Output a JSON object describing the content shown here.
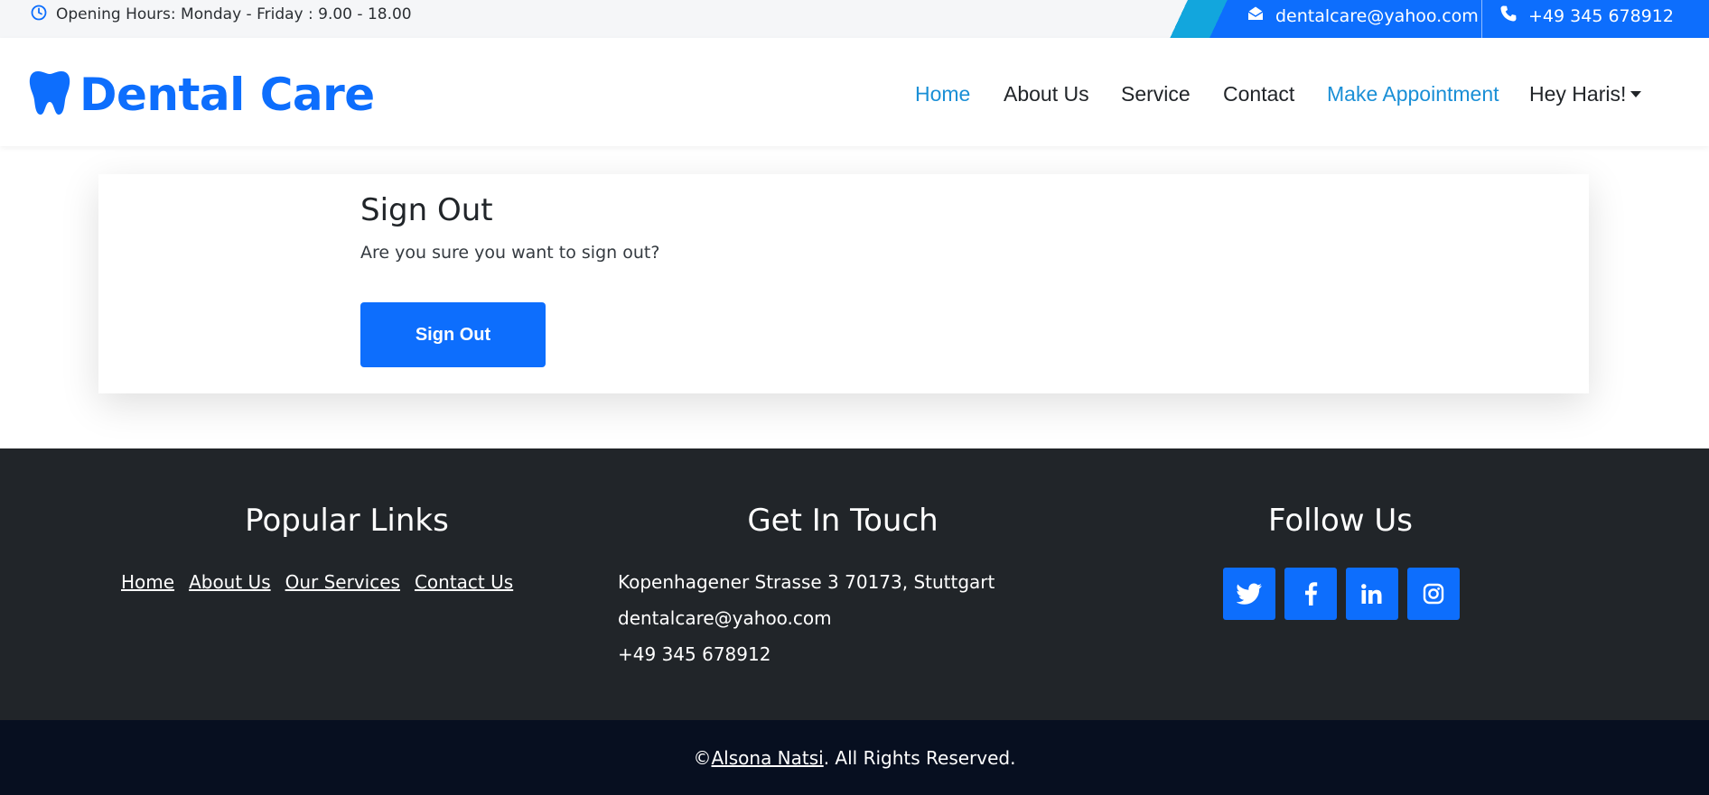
{
  "topbar": {
    "hours_text": "Opening Hours: Monday - Friday : 9.00 - 18.00",
    "email": "dentalcare@yahoo.com",
    "phone": "+49 345 678912",
    "hours_icon": "clock-icon",
    "email_icon": "envelope-open-icon",
    "phone_icon": "phone-icon"
  },
  "navbar": {
    "brand": "Dental Care",
    "brand_icon": "tooth-icon",
    "items": [
      {
        "label": "Home",
        "active": true
      },
      {
        "label": "About Us"
      },
      {
        "label": "Service"
      },
      {
        "label": "Contact"
      },
      {
        "label": "Make Appointment"
      },
      {
        "label": "Hey Haris!",
        "dropdown": true
      }
    ]
  },
  "card": {
    "title": "Sign Out",
    "message": "Are you sure you want to sign out?",
    "button_label": "Sign Out"
  },
  "footer": {
    "popular_links": {
      "title": "Popular Links",
      "items": [
        "Home",
        "About Us",
        "Our Services",
        "Contact Us"
      ]
    },
    "get_in_touch": {
      "title": "Get In Touch",
      "address": "Kopenhagener Strasse 3 70173, Stuttgart",
      "email": "dentalcare@yahoo.com",
      "phone": "+49 345 678912"
    },
    "follow_us": {
      "title": "Follow Us",
      "icons": [
        "twitter-icon",
        "facebook-icon",
        "linkedin-icon",
        "instagram-icon"
      ]
    }
  },
  "bottom": {
    "prefix": "© ",
    "author": "Alsona Natsi",
    "suffix": ". All Rights Reserved."
  },
  "colors": {
    "primary": "#0d6efd",
    "nav_active": "#1a8fd6",
    "footer_bg": "#212529",
    "bottom_bg": "#070f20"
  }
}
